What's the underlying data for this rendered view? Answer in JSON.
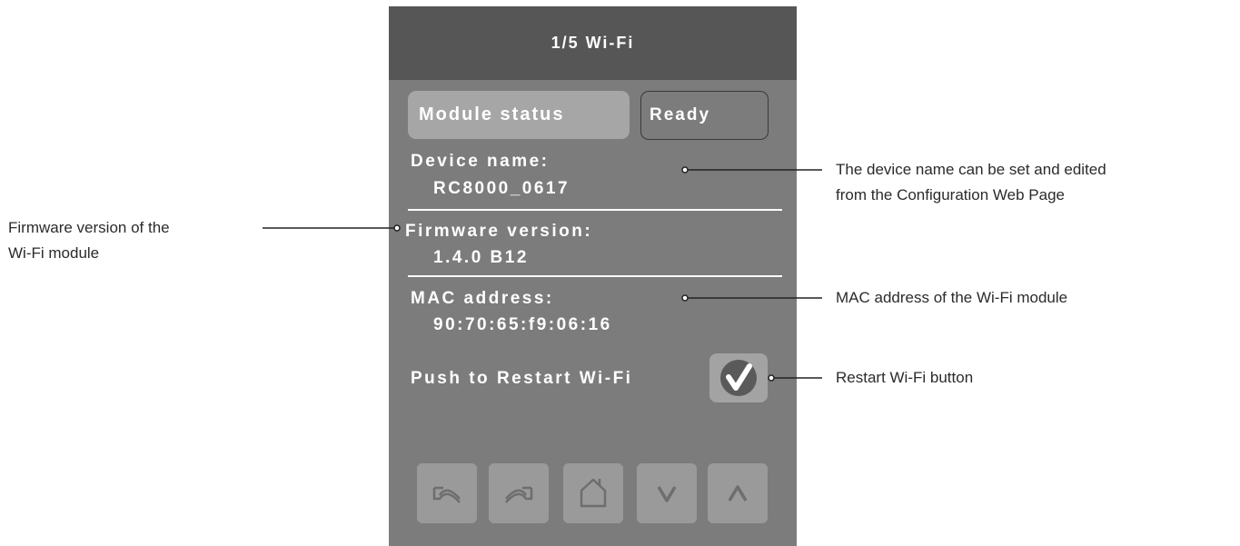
{
  "screen": {
    "title": "1/5 Wi-Fi",
    "module_status_label": "Module status",
    "module_status_value": "Ready",
    "device_name_label": "Device name:",
    "device_name_value": "RC8000_0617",
    "firmware_label": "Firmware version:",
    "firmware_value": "1.4.0 B12",
    "mac_label": "MAC address:",
    "mac_value": "90:70:65:f9:06:16",
    "restart_label": "Push to Restart Wi-Fi"
  },
  "nav_buttons": [
    {
      "icon": "back-arrow-icon"
    },
    {
      "icon": "forward-arrow-icon"
    },
    {
      "icon": "home-icon"
    },
    {
      "icon": "chevron-down-icon"
    },
    {
      "icon": "chevron-up-icon"
    }
  ],
  "callouts": {
    "firmware": "Firmware version of the\nWi-Fi module",
    "device_name": "The device name can be set and edited\nfrom the Configuration Web Page",
    "mac": "MAC address of the Wi-Fi module",
    "restart": "Restart Wi-Fi button"
  },
  "colors": {
    "panel": "#7c7c7c",
    "titlebar": "#565656",
    "button": "#a3a3a3",
    "check": "#5a5a5a"
  }
}
